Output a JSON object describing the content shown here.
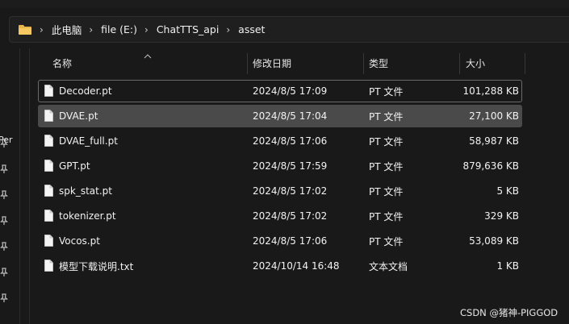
{
  "address": {
    "icon": "folder-icon",
    "crumbs": [
      "此电脑",
      "file (E:)",
      "ChatTTS_api",
      "asset"
    ]
  },
  "nav": {
    "partial_label": "Per"
  },
  "columns": {
    "name": "名称",
    "date": "修改日期",
    "type": "类型",
    "size": "大小"
  },
  "files": [
    {
      "name": "Decoder.pt",
      "date": "2024/8/5 17:09",
      "type": "PT 文件",
      "size": "101,288 KB"
    },
    {
      "name": "DVAE.pt",
      "date": "2024/8/5 17:04",
      "type": "PT 文件",
      "size": "27,100 KB"
    },
    {
      "name": "DVAE_full.pt",
      "date": "2024/8/5 17:06",
      "type": "PT 文件",
      "size": "58,987 KB"
    },
    {
      "name": "GPT.pt",
      "date": "2024/8/5 17:59",
      "type": "PT 文件",
      "size": "879,636 KB"
    },
    {
      "name": "spk_stat.pt",
      "date": "2024/8/5 17:02",
      "type": "PT 文件",
      "size": "5 KB"
    },
    {
      "name": "tokenizer.pt",
      "date": "2024/8/5 17:02",
      "type": "PT 文件",
      "size": "329 KB"
    },
    {
      "name": "Vocos.pt",
      "date": "2024/8/5 17:06",
      "type": "PT 文件",
      "size": "53,089 KB"
    },
    {
      "name": "模型下载说明.txt",
      "date": "2024/10/14 16:48",
      "type": "文本文档",
      "size": "1 KB"
    }
  ],
  "watermark": "CSDN @猪神-PIGGOD",
  "colors": {
    "background": "#191919",
    "selected_row": "#4a4a4a",
    "folder": "#e8b54a"
  }
}
